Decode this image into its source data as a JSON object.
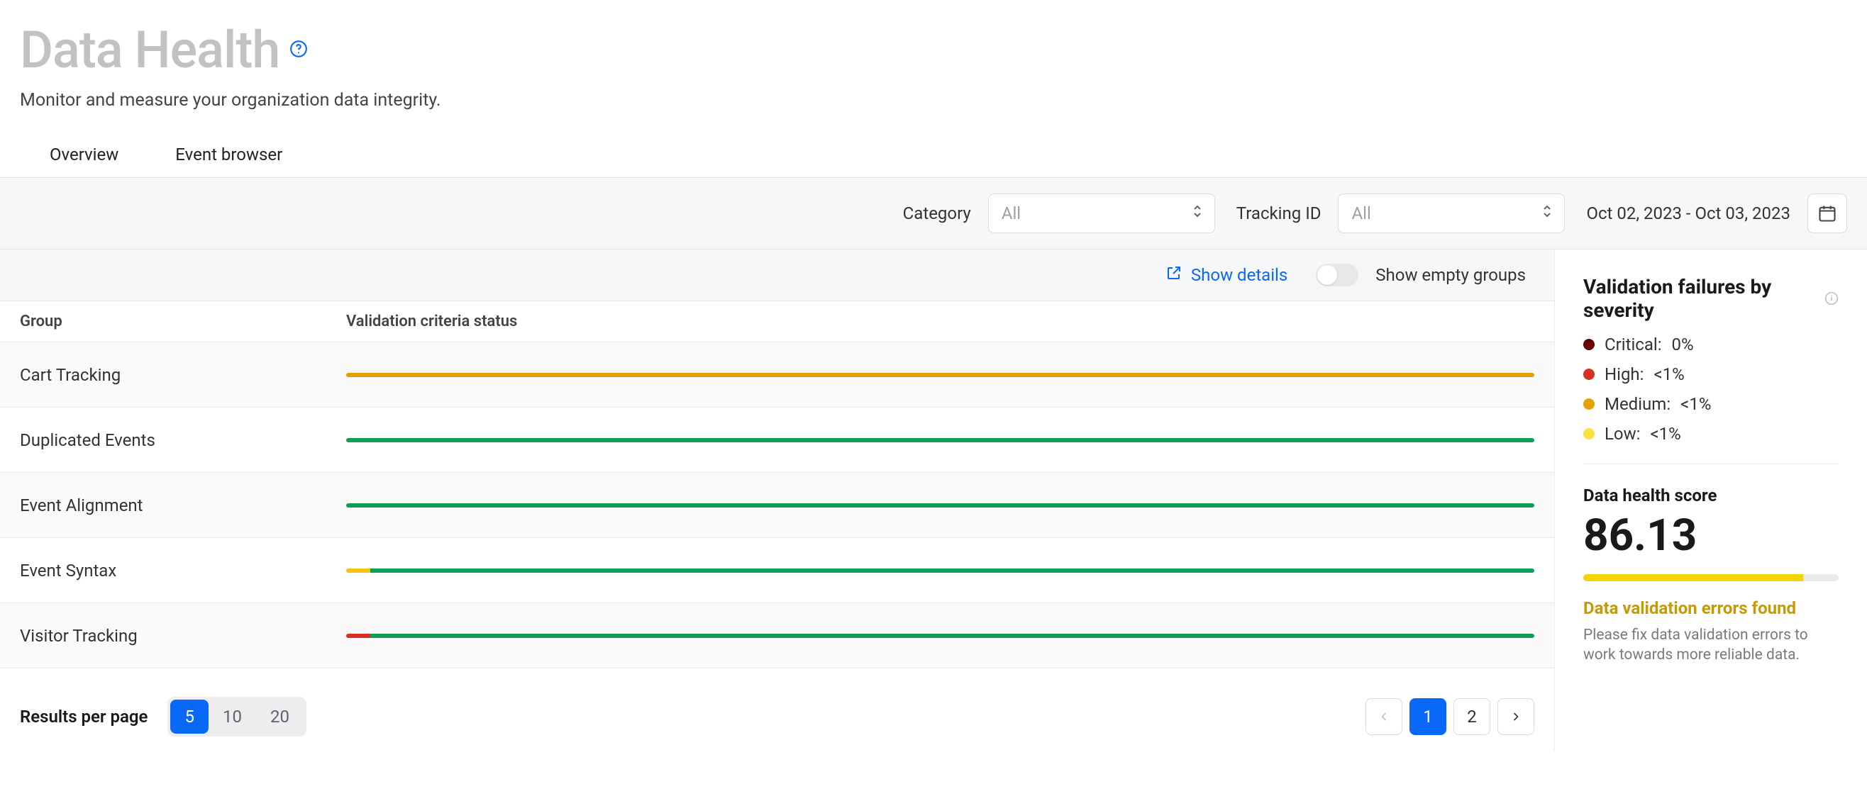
{
  "header": {
    "title": "Data Health",
    "subtitle": "Monitor and measure your organization data integrity."
  },
  "tabs": [
    {
      "label": "Overview"
    },
    {
      "label": "Event browser"
    }
  ],
  "filters": {
    "category_label": "Category",
    "category_value": "All",
    "tracking_label": "Tracking ID",
    "tracking_value": "All",
    "date_range": "Oct 02, 2023 - Oct 03, 2023"
  },
  "subbar": {
    "show_details": "Show details",
    "show_empty": "Show empty groups"
  },
  "table": {
    "header_group": "Group",
    "header_status": "Validation criteria status",
    "rows": [
      {
        "name": "Cart Tracking",
        "segments": [
          {
            "color": "orange",
            "pct": 100
          }
        ]
      },
      {
        "name": "Duplicated Events",
        "segments": [
          {
            "color": "green",
            "pct": 100
          }
        ]
      },
      {
        "name": "Event Alignment",
        "segments": [
          {
            "color": "green",
            "pct": 100
          }
        ]
      },
      {
        "name": "Event Syntax",
        "segments": [
          {
            "color": "yellow",
            "pct": 2
          },
          {
            "color": "green",
            "pct": 98
          }
        ]
      },
      {
        "name": "Visitor Tracking",
        "segments": [
          {
            "color": "red",
            "pct": 2
          },
          {
            "color": "green",
            "pct": 98
          }
        ]
      }
    ]
  },
  "footer": {
    "rpp_label": "Results per page",
    "rpp_options": [
      "5",
      "10",
      "20"
    ],
    "rpp_selected": "5",
    "pages": [
      "1",
      "2"
    ],
    "current_page": "1"
  },
  "sidebar": {
    "sev_title": "Validation failures by severity",
    "severities": [
      {
        "label": "Critical:",
        "value": "0%",
        "dot": "crit"
      },
      {
        "label": "High:",
        "value": "<1%",
        "dot": "high"
      },
      {
        "label": "Medium:",
        "value": "<1%",
        "dot": "med"
      },
      {
        "label": "Low:",
        "value": "<1%",
        "dot": "low"
      }
    ],
    "score_label": "Data health score",
    "score_value": "86.13",
    "score_pct": 86,
    "err_title": "Data validation errors found",
    "err_text": "Please fix data validation errors to work towards more reliable data."
  }
}
